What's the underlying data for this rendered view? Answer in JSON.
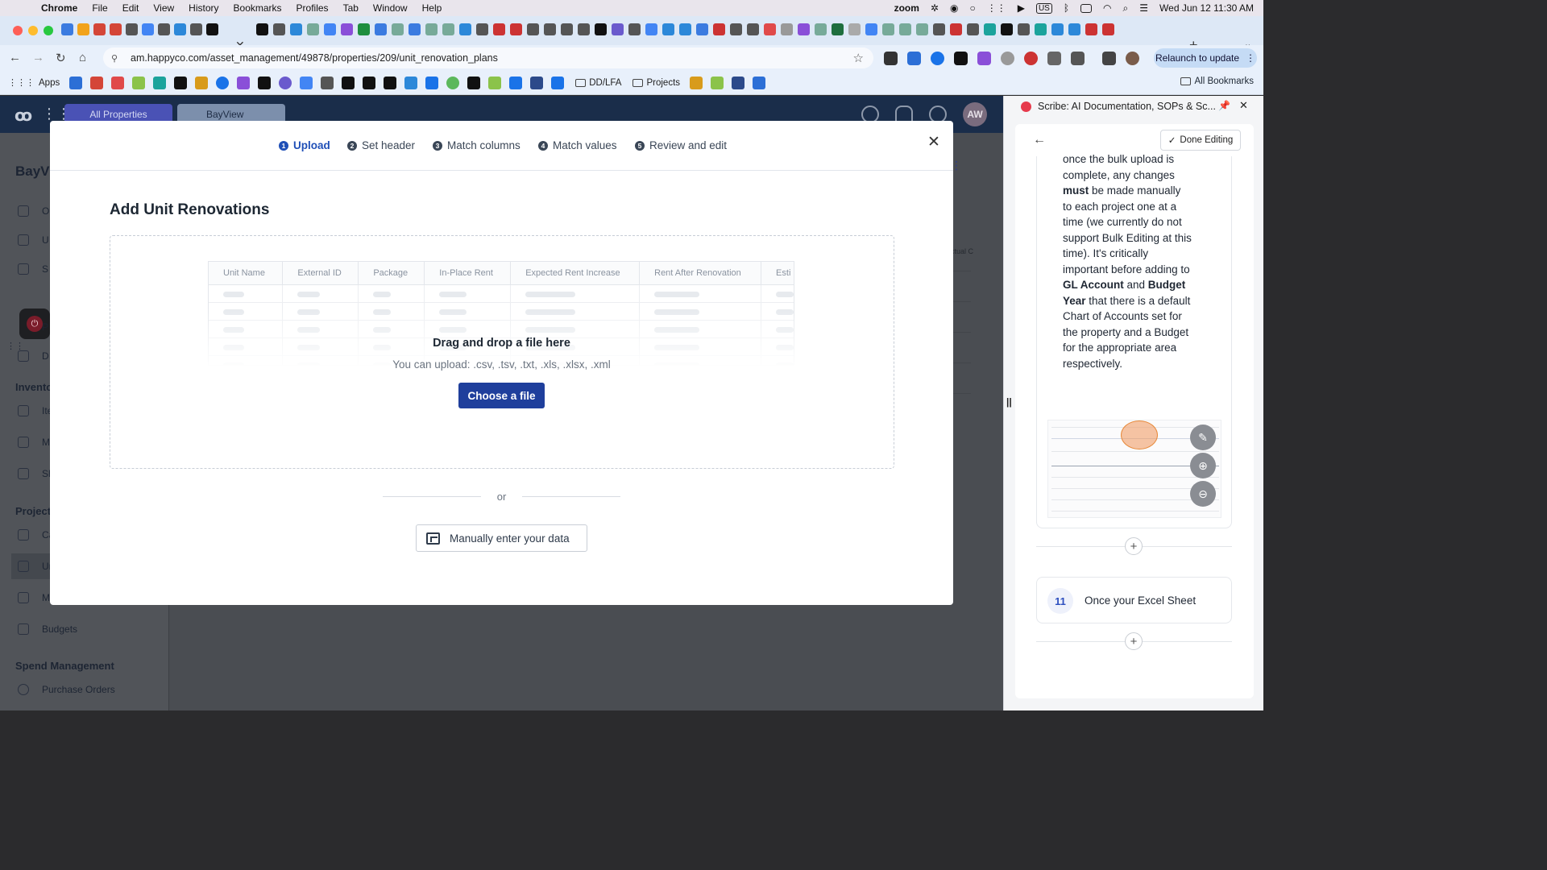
{
  "menubar": {
    "app": "Chrome",
    "items": [
      "File",
      "Edit",
      "View",
      "History",
      "Bookmarks",
      "Profiles",
      "Tab",
      "Window",
      "Help"
    ],
    "zoom_label": "zoom",
    "datetime": "Wed Jun 12  11:30 AM",
    "input_source": "US"
  },
  "browser": {
    "url": "am.happyco.com/asset_management/49878/properties/209/unit_renovation_plans",
    "relaunch_label": "Relaunch to update",
    "bookmarks": {
      "apps_label": "Apps",
      "folders": [
        "DD/LFA",
        "Projects"
      ],
      "all_label": "All Bookmarks"
    }
  },
  "app": {
    "tabs": [
      "All Properties",
      "BayView"
    ],
    "avatar_initials": "AW",
    "property_title_partial": "BayVi",
    "nav_items": [
      "O",
      "U",
      "S",
      "P",
      "D"
    ],
    "sections": {
      "inventory": "Invento",
      "inventory_items": [
        "Ite",
        "M",
        "Sh"
      ],
      "projects": "Project",
      "projects_items": [
        "Ca",
        "Ur",
        "M"
      ],
      "budgets": "Budgets",
      "spend_management": "Spend Management",
      "purchase_orders": "Purchase Orders"
    },
    "bg_column_fragment": "ctual C"
  },
  "modal": {
    "steps": [
      {
        "num": "1",
        "label": "Upload",
        "active": true
      },
      {
        "num": "2",
        "label": "Set header",
        "active": false
      },
      {
        "num": "3",
        "label": "Match columns",
        "active": false
      },
      {
        "num": "4",
        "label": "Match values",
        "active": false
      },
      {
        "num": "5",
        "label": "Review and edit",
        "active": false
      }
    ],
    "title": "Add Unit Renovations",
    "preview_columns": [
      "Unit Name",
      "External ID",
      "Package",
      "In-Place Rent",
      "Expected Rent Increase",
      "Rent After Renovation",
      "Esti"
    ],
    "drop_title": "Drag and drop a file here",
    "drop_subtitle": "You can upload: .csv, .tsv, .txt, .xls, .xlsx, .xml",
    "choose_file_label": "Choose a file",
    "or_label": "or",
    "manual_entry_label": "Manually enter your data"
  },
  "scribe": {
    "title": "Scribe: AI Documentation, SOPs & Sc...",
    "done_editing_label": "Done Editing",
    "step10_text_html": "once the bulk upload is complete, any changes <b>must</b> be made manually to each project one at a time (we currently do not support Bulk Editing at this time). It's critically important before adding to <b>GL Account</b> and <b>Budget Year</b> that there is a default Chart of Accounts set for the property and a Budget for the appropriate area respectively.",
    "step11": {
      "num": "11",
      "text": "Once your Excel Sheet"
    }
  },
  "colors": {
    "accent": "#1f4fb7",
    "primary_button": "#1f3f9c",
    "scribe_brand": "#e63a4c",
    "app_header": "#1a2d4a"
  }
}
